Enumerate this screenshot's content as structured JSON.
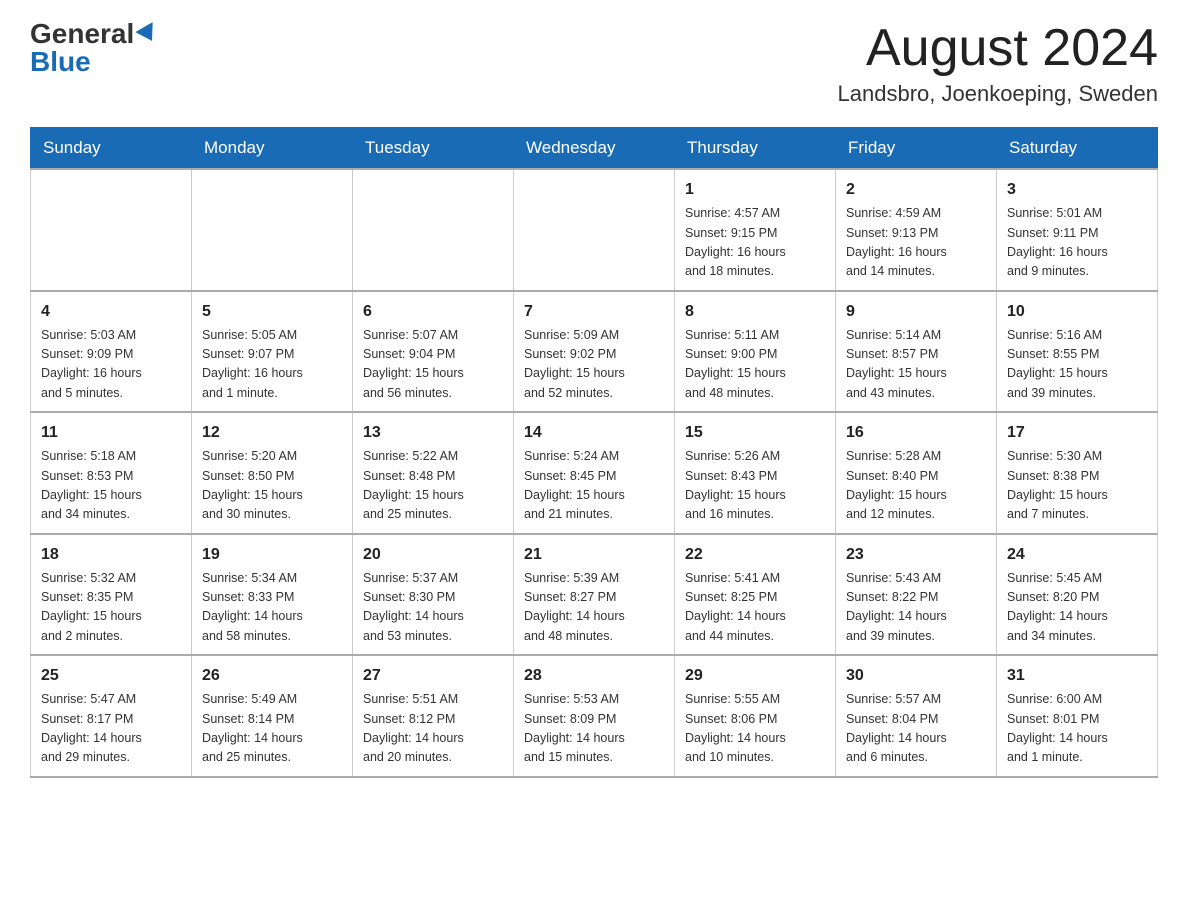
{
  "header": {
    "logo": {
      "general": "General",
      "blue": "Blue"
    },
    "title": "August 2024",
    "location": "Landsbro, Joenkoeping, Sweden"
  },
  "calendar": {
    "days_of_week": [
      "Sunday",
      "Monday",
      "Tuesday",
      "Wednesday",
      "Thursday",
      "Friday",
      "Saturday"
    ],
    "weeks": [
      [
        {
          "day": "",
          "info": ""
        },
        {
          "day": "",
          "info": ""
        },
        {
          "day": "",
          "info": ""
        },
        {
          "day": "",
          "info": ""
        },
        {
          "day": "1",
          "info": "Sunrise: 4:57 AM\nSunset: 9:15 PM\nDaylight: 16 hours\nand 18 minutes."
        },
        {
          "day": "2",
          "info": "Sunrise: 4:59 AM\nSunset: 9:13 PM\nDaylight: 16 hours\nand 14 minutes."
        },
        {
          "day": "3",
          "info": "Sunrise: 5:01 AM\nSunset: 9:11 PM\nDaylight: 16 hours\nand 9 minutes."
        }
      ],
      [
        {
          "day": "4",
          "info": "Sunrise: 5:03 AM\nSunset: 9:09 PM\nDaylight: 16 hours\nand 5 minutes."
        },
        {
          "day": "5",
          "info": "Sunrise: 5:05 AM\nSunset: 9:07 PM\nDaylight: 16 hours\nand 1 minute."
        },
        {
          "day": "6",
          "info": "Sunrise: 5:07 AM\nSunset: 9:04 PM\nDaylight: 15 hours\nand 56 minutes."
        },
        {
          "day": "7",
          "info": "Sunrise: 5:09 AM\nSunset: 9:02 PM\nDaylight: 15 hours\nand 52 minutes."
        },
        {
          "day": "8",
          "info": "Sunrise: 5:11 AM\nSunset: 9:00 PM\nDaylight: 15 hours\nand 48 minutes."
        },
        {
          "day": "9",
          "info": "Sunrise: 5:14 AM\nSunset: 8:57 PM\nDaylight: 15 hours\nand 43 minutes."
        },
        {
          "day": "10",
          "info": "Sunrise: 5:16 AM\nSunset: 8:55 PM\nDaylight: 15 hours\nand 39 minutes."
        }
      ],
      [
        {
          "day": "11",
          "info": "Sunrise: 5:18 AM\nSunset: 8:53 PM\nDaylight: 15 hours\nand 34 minutes."
        },
        {
          "day": "12",
          "info": "Sunrise: 5:20 AM\nSunset: 8:50 PM\nDaylight: 15 hours\nand 30 minutes."
        },
        {
          "day": "13",
          "info": "Sunrise: 5:22 AM\nSunset: 8:48 PM\nDaylight: 15 hours\nand 25 minutes."
        },
        {
          "day": "14",
          "info": "Sunrise: 5:24 AM\nSunset: 8:45 PM\nDaylight: 15 hours\nand 21 minutes."
        },
        {
          "day": "15",
          "info": "Sunrise: 5:26 AM\nSunset: 8:43 PM\nDaylight: 15 hours\nand 16 minutes."
        },
        {
          "day": "16",
          "info": "Sunrise: 5:28 AM\nSunset: 8:40 PM\nDaylight: 15 hours\nand 12 minutes."
        },
        {
          "day": "17",
          "info": "Sunrise: 5:30 AM\nSunset: 8:38 PM\nDaylight: 15 hours\nand 7 minutes."
        }
      ],
      [
        {
          "day": "18",
          "info": "Sunrise: 5:32 AM\nSunset: 8:35 PM\nDaylight: 15 hours\nand 2 minutes."
        },
        {
          "day": "19",
          "info": "Sunrise: 5:34 AM\nSunset: 8:33 PM\nDaylight: 14 hours\nand 58 minutes."
        },
        {
          "day": "20",
          "info": "Sunrise: 5:37 AM\nSunset: 8:30 PM\nDaylight: 14 hours\nand 53 minutes."
        },
        {
          "day": "21",
          "info": "Sunrise: 5:39 AM\nSunset: 8:27 PM\nDaylight: 14 hours\nand 48 minutes."
        },
        {
          "day": "22",
          "info": "Sunrise: 5:41 AM\nSunset: 8:25 PM\nDaylight: 14 hours\nand 44 minutes."
        },
        {
          "day": "23",
          "info": "Sunrise: 5:43 AM\nSunset: 8:22 PM\nDaylight: 14 hours\nand 39 minutes."
        },
        {
          "day": "24",
          "info": "Sunrise: 5:45 AM\nSunset: 8:20 PM\nDaylight: 14 hours\nand 34 minutes."
        }
      ],
      [
        {
          "day": "25",
          "info": "Sunrise: 5:47 AM\nSunset: 8:17 PM\nDaylight: 14 hours\nand 29 minutes."
        },
        {
          "day": "26",
          "info": "Sunrise: 5:49 AM\nSunset: 8:14 PM\nDaylight: 14 hours\nand 25 minutes."
        },
        {
          "day": "27",
          "info": "Sunrise: 5:51 AM\nSunset: 8:12 PM\nDaylight: 14 hours\nand 20 minutes."
        },
        {
          "day": "28",
          "info": "Sunrise: 5:53 AM\nSunset: 8:09 PM\nDaylight: 14 hours\nand 15 minutes."
        },
        {
          "day": "29",
          "info": "Sunrise: 5:55 AM\nSunset: 8:06 PM\nDaylight: 14 hours\nand 10 minutes."
        },
        {
          "day": "30",
          "info": "Sunrise: 5:57 AM\nSunset: 8:04 PM\nDaylight: 14 hours\nand 6 minutes."
        },
        {
          "day": "31",
          "info": "Sunrise: 6:00 AM\nSunset: 8:01 PM\nDaylight: 14 hours\nand 1 minute."
        }
      ]
    ]
  }
}
